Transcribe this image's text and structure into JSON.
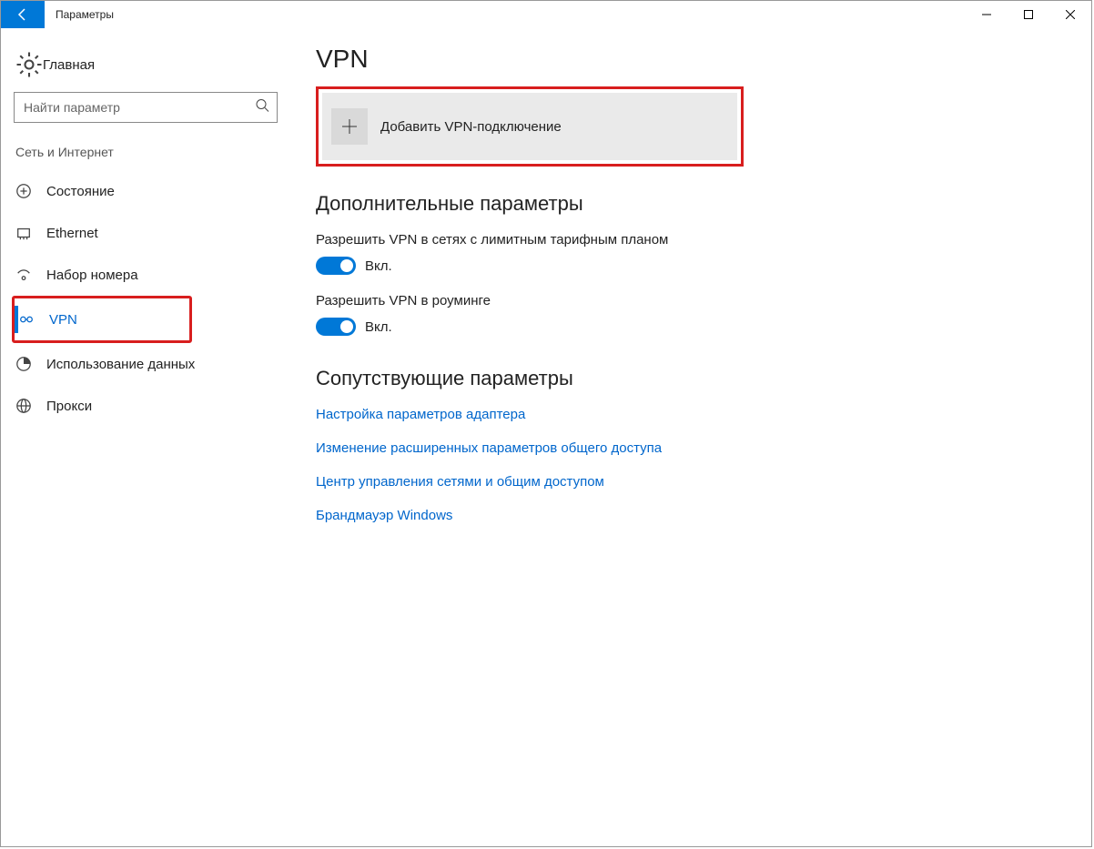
{
  "window": {
    "title": "Параметры"
  },
  "sidebar": {
    "home_label": "Главная",
    "search_placeholder": "Найти параметр",
    "section_label": "Сеть и Интернет",
    "items": [
      {
        "label": "Состояние"
      },
      {
        "label": "Ethernet"
      },
      {
        "label": "Набор номера"
      },
      {
        "label": "VPN"
      },
      {
        "label": "Использование данных"
      },
      {
        "label": "Прокси"
      }
    ]
  },
  "content": {
    "page_title": "VPN",
    "add_button_label": "Добавить VPN-подключение",
    "advanced_title": "Дополнительные параметры",
    "settings": [
      {
        "label": "Разрешить VPN в сетях с лимитным тарифным планом",
        "state_label": "Вкл."
      },
      {
        "label": "Разрешить VPN в роуминге",
        "state_label": "Вкл."
      }
    ],
    "related_title": "Сопутствующие параметры",
    "related_links": [
      "Настройка параметров адаптера",
      "Изменение расширенных параметров общего доступа",
      "Центр управления сетями и общим доступом",
      "Брандмауэр Windows"
    ]
  }
}
